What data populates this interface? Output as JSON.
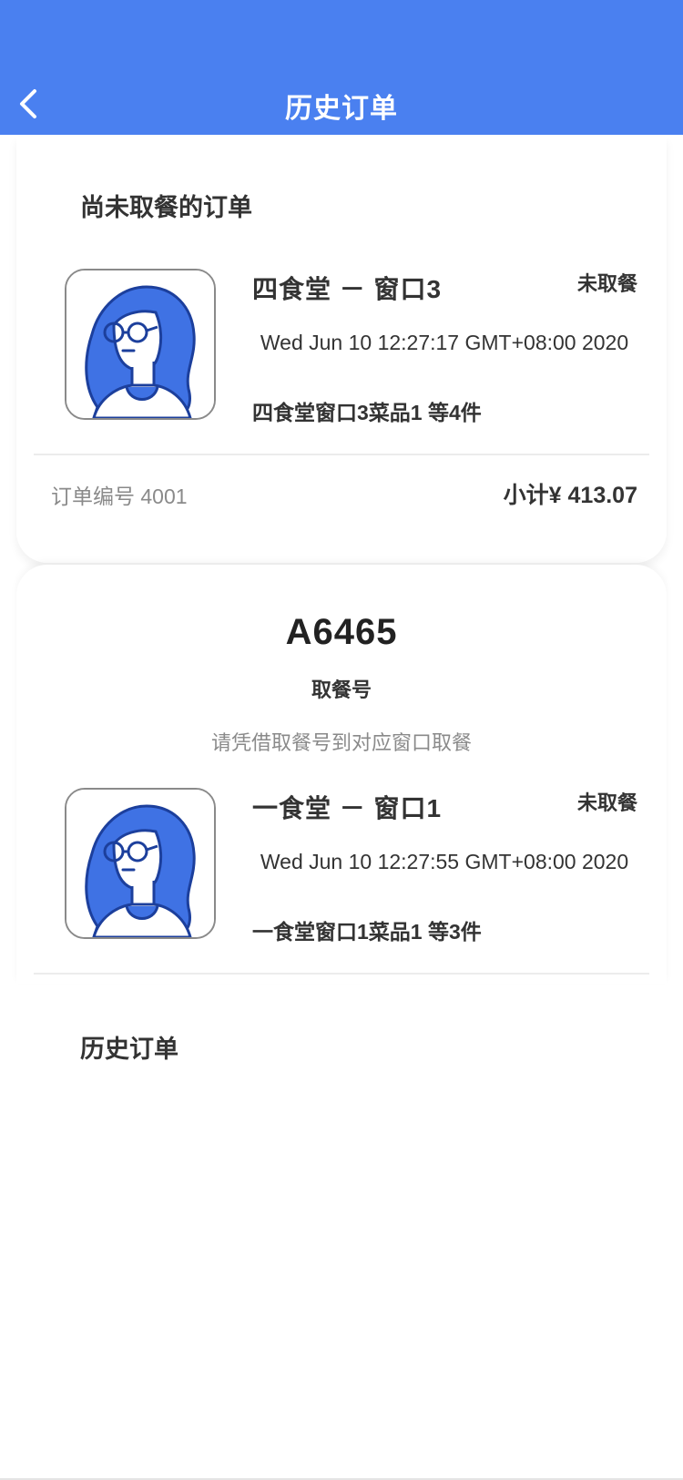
{
  "header": {
    "title": "历史订单",
    "back_icon": "chevron-left-icon",
    "color": "#4a80f0"
  },
  "pending_section": {
    "title": "尚未取餐的订单"
  },
  "orders": [
    {
      "canteen": "四食堂 － 窗口3",
      "status": "未取餐",
      "time": "Wed Jun 10 12:27:17 GMT+08:00 2020",
      "items": "四食堂窗口3菜品1 等4件",
      "order_no": "订单编号 4001",
      "subtotal": "小计¥ 413.07",
      "avatar_icon": "avatar-woman-glasses-icon"
    },
    {
      "pickup_code": "A6465",
      "pickup_label": "取餐号",
      "pickup_hint": "请凭借取餐号到对应窗口取餐",
      "canteen": "一食堂 － 窗口1",
      "status": "未取餐",
      "time": "Wed Jun 10 12:27:55 GMT+08:00 2020",
      "items": "一食堂窗口1菜品1 等3件",
      "avatar_icon": "avatar-woman-glasses-icon"
    }
  ],
  "history_section": {
    "title": "历史订单"
  }
}
